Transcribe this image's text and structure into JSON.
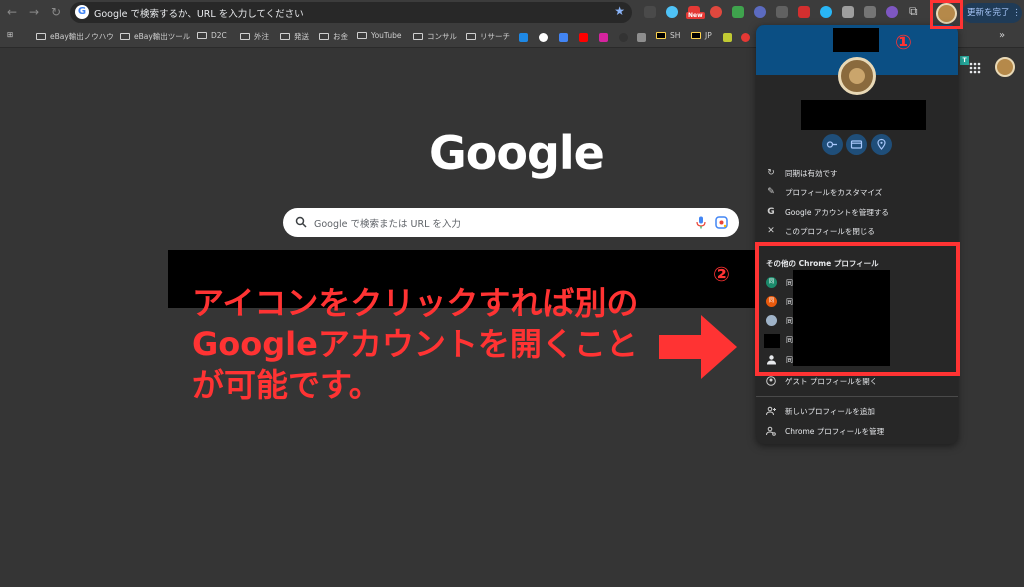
{
  "browser": {
    "omnibox_placeholder": "Google で検索するか、URL を入力してください",
    "omnibox_icon": "G",
    "update_label": "更新を完了",
    "new_badge": "New",
    "teal_chip": "T",
    "bookmarks": [
      {
        "label": "eBay輸出ノウハウ",
        "type": "folder"
      },
      {
        "label": "eBay輸出ツール",
        "type": "folder"
      },
      {
        "label": "D2C",
        "type": "folder"
      },
      {
        "label": "外注",
        "type": "folder"
      },
      {
        "label": "発送",
        "type": "folder"
      },
      {
        "label": "お金",
        "type": "folder"
      },
      {
        "label": "YouTube",
        "type": "folder"
      },
      {
        "label": "コンサル",
        "type": "folder"
      },
      {
        "label": "リサーチ",
        "type": "folder"
      },
      {
        "label": "SH",
        "type": "link"
      },
      {
        "label": "JP",
        "type": "link"
      }
    ]
  },
  "page": {
    "logo_text": "Google",
    "search_placeholder": "Google で検索または URL を入力"
  },
  "profile_menu": {
    "items": [
      {
        "icon": "sync-icon",
        "label": "同期は有効です"
      },
      {
        "icon": "pencil-icon",
        "label": "プロフィールをカスタマイズ"
      },
      {
        "icon": "google-g-icon",
        "label": "Google アカウントを管理する"
      },
      {
        "icon": "close-icon",
        "label": "このプロフィールを閉じる"
      }
    ],
    "other_profiles_title": "その他の Chrome プロフィール",
    "profiles": [
      {
        "initial": "同",
        "color": "#1b8a6b",
        "name": "同"
      },
      {
        "initial": "同",
        "color": "#e8590c",
        "name": "同"
      },
      {
        "initial": "",
        "color": "#9fb3c8",
        "name": "同"
      },
      {
        "initial": "",
        "color": "#000000",
        "name": "同"
      },
      {
        "initial": "",
        "color": "#e8eaed",
        "name": "同"
      }
    ],
    "guest_label": "ゲスト プロフィールを開く",
    "add_profile_label": "新しいプロフィールを追加",
    "manage_profiles_label": "Chrome プロフィールを管理"
  },
  "annotation": {
    "text": "アイコンをクリックすれば別のGoogleアカウントを開くことが可能です。",
    "marker_1": "①",
    "marker_2": "②",
    "color": "#ff3333"
  }
}
